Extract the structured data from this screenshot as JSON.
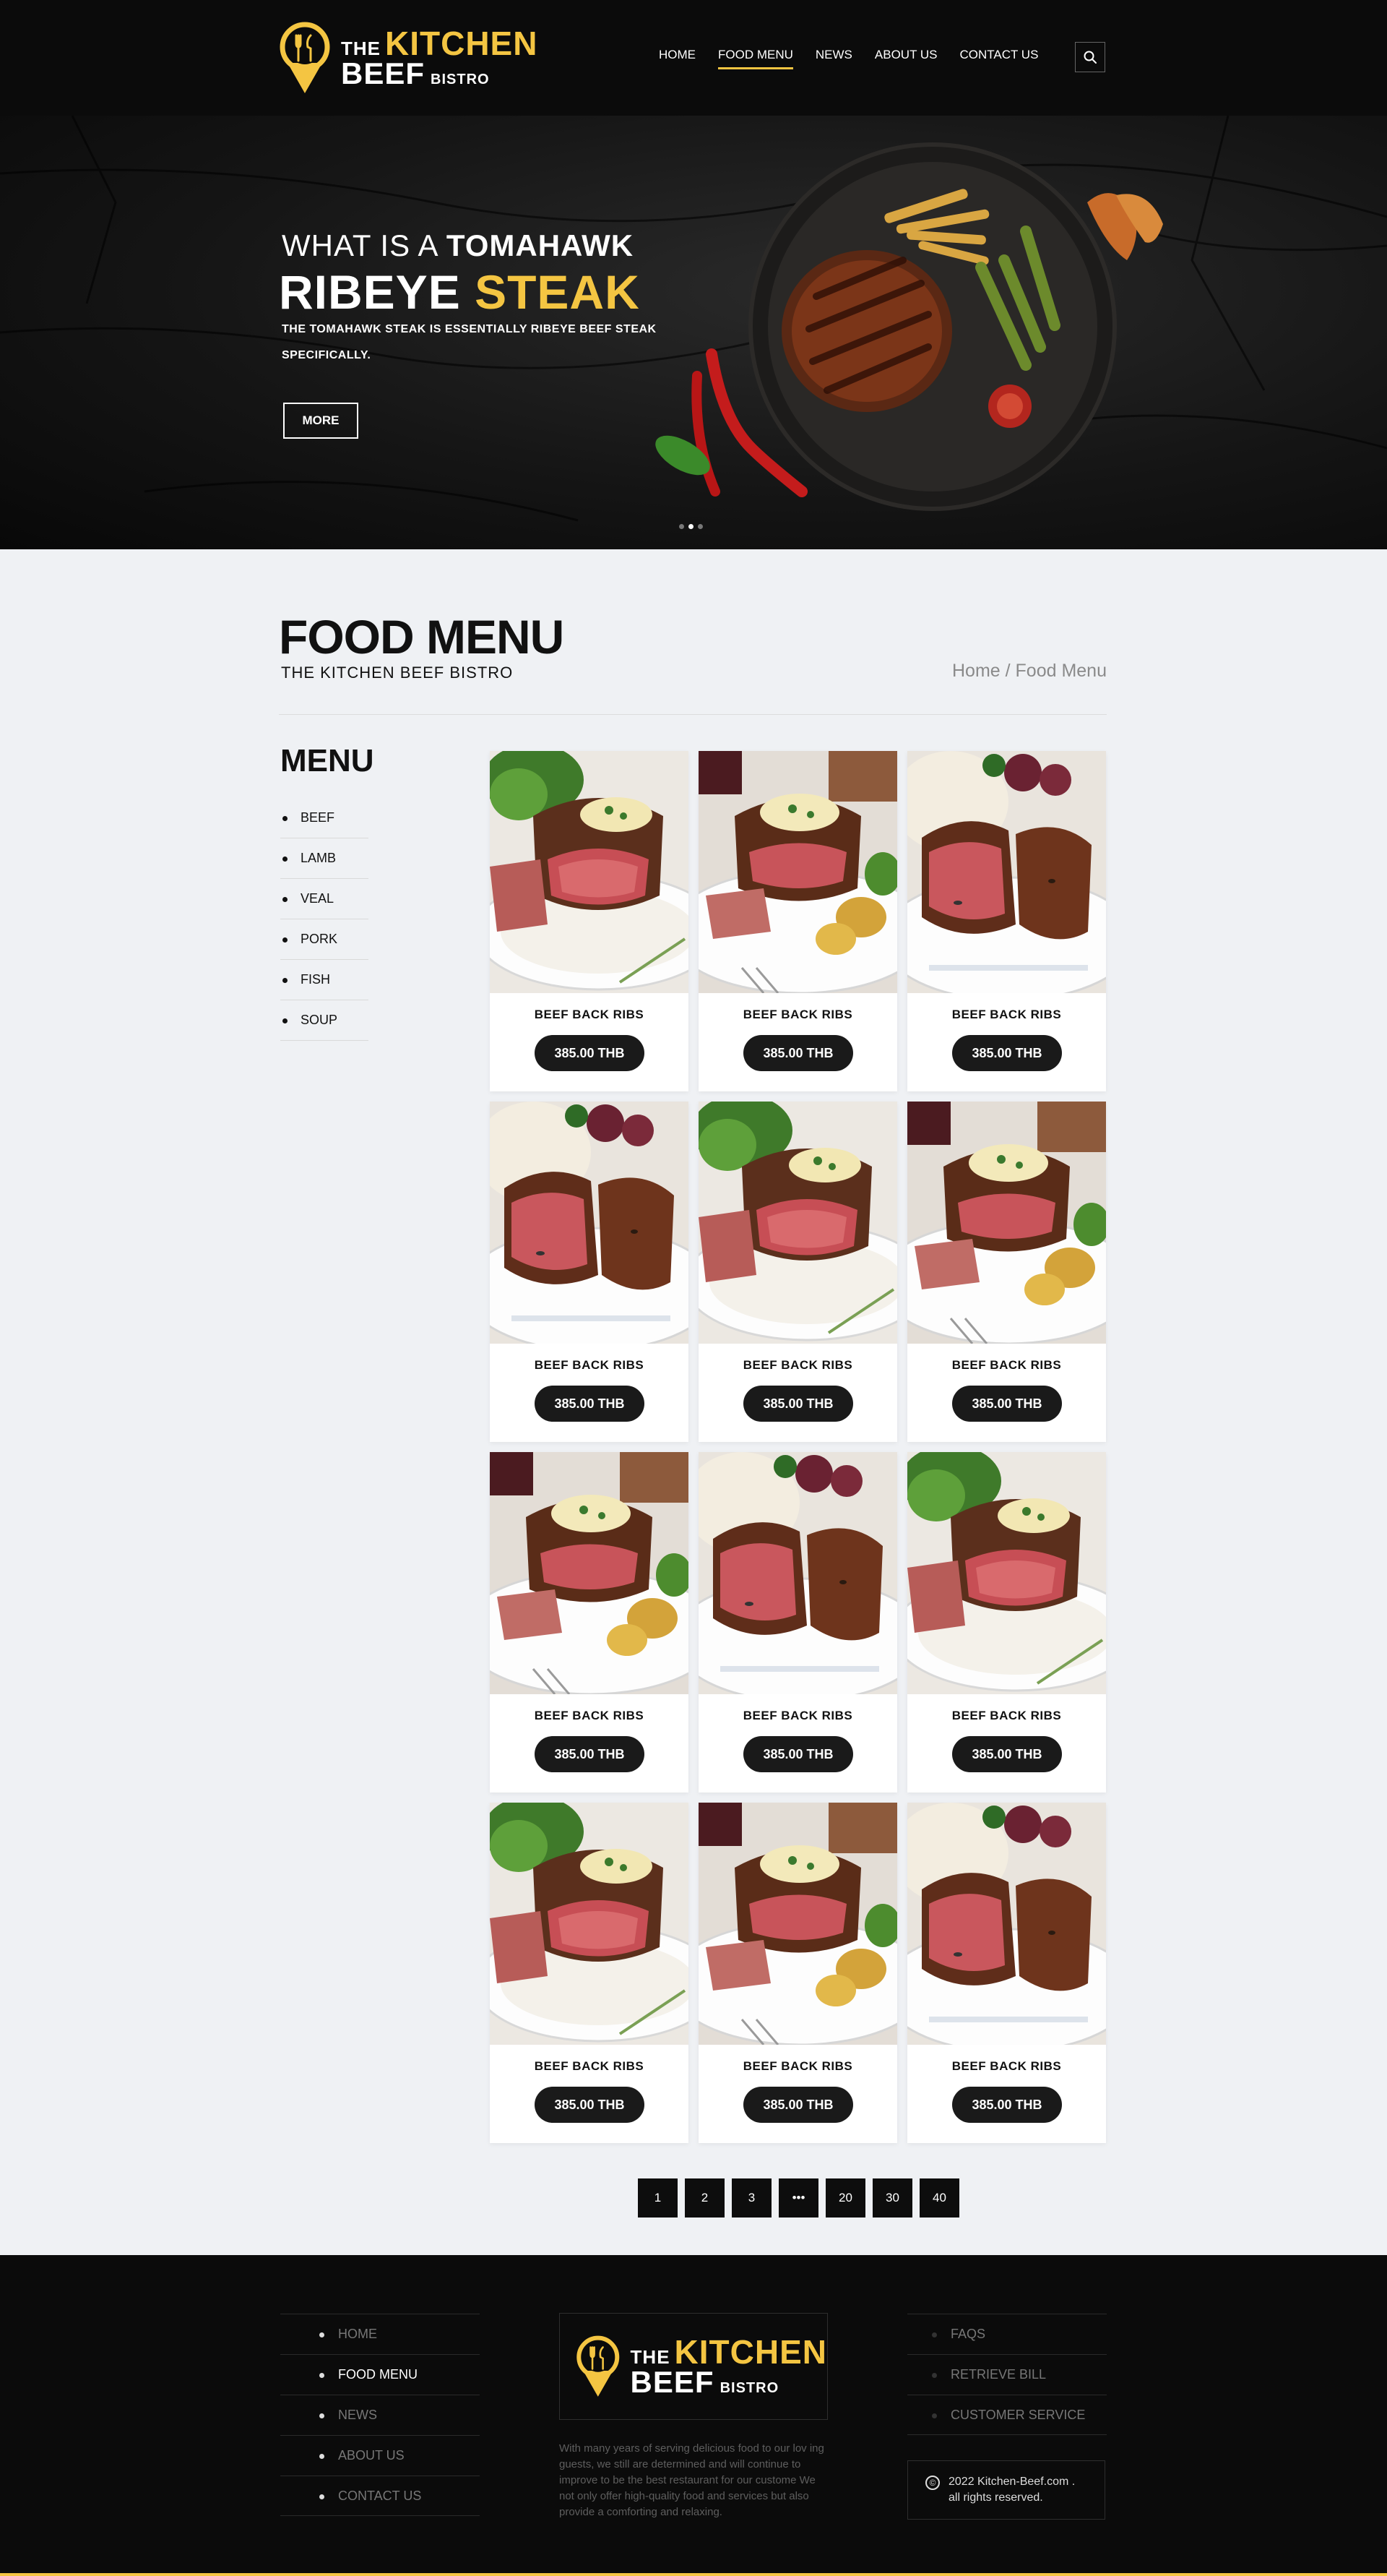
{
  "brand": {
    "the": "THE",
    "kitchen": "KITCHEN",
    "beef": "BEEF",
    "bistro": "BISTRO"
  },
  "nav": [
    {
      "label": "HOME"
    },
    {
      "label": "FOOD MENU",
      "active": true
    },
    {
      "label": "NEWS"
    },
    {
      "label": "ABOUT US"
    },
    {
      "label": "CONTACT US"
    }
  ],
  "search": {
    "icon": "search-icon"
  },
  "hero": {
    "line1_a": "WHAT IS A",
    "line1_b": "TOMAHAWK",
    "line2_a": "RIBEYE",
    "line2_b": "STEAK",
    "subtitle": "THE TOMAHAWK STEAK IS ESSENTIALLY RIBEYE BEEF STEAK SPECIFICALLY.",
    "button": "MORE",
    "slides": 3,
    "active_slide": 2
  },
  "page": {
    "title": "FOOD MENU",
    "subtitle": "THE KITCHEN BEEF BISTRO",
    "breadcrumb": "Home / Food Menu"
  },
  "sidebar": {
    "heading": "MENU",
    "items": [
      {
        "label": "BEEF"
      },
      {
        "label": "LAMB"
      },
      {
        "label": "VEAL"
      },
      {
        "label": "PORK"
      },
      {
        "label": "FISH"
      },
      {
        "label": "SOUP"
      }
    ]
  },
  "products": [
    {
      "name": "BEEF BACK RIBS",
      "price": "385.00  THB"
    },
    {
      "name": "BEEF BACK RIBS",
      "price": "385.00  THB"
    },
    {
      "name": "BEEF BACK RIBS",
      "price": "385.00  THB"
    },
    {
      "name": "BEEF BACK RIBS",
      "price": "385.00  THB"
    },
    {
      "name": "BEEF BACK RIBS",
      "price": "385.00  THB"
    },
    {
      "name": "BEEF BACK RIBS",
      "price": "385.00  THB"
    },
    {
      "name": "BEEF BACK RIBS",
      "price": "385.00  THB"
    },
    {
      "name": "BEEF BACK RIBS",
      "price": "385.00  THB"
    },
    {
      "name": "BEEF BACK RIBS",
      "price": "385.00  THB"
    },
    {
      "name": "BEEF BACK RIBS",
      "price": "385.00  THB"
    },
    {
      "name": "BEEF BACK RIBS",
      "price": "385.00  THB"
    },
    {
      "name": "BEEF BACK RIBS",
      "price": "385.00  THB"
    }
  ],
  "pagination": [
    "1",
    "2",
    "3",
    "•••",
    "20",
    "30",
    "40"
  ],
  "footer": {
    "left_links": [
      {
        "label": "HOME"
      },
      {
        "label": "FOOD MENU",
        "active": true
      },
      {
        "label": "NEWS"
      },
      {
        "label": "ABOUT US"
      },
      {
        "label": "CONTACT US"
      }
    ],
    "right_links": [
      {
        "label": "FAQS"
      },
      {
        "label": "RETRIEVE BILL"
      },
      {
        "label": "CUSTOMER SERVICE"
      }
    ],
    "description": "With many years of serving delicious food to our lov ing guests, we still are determined and will continue to improve to be the best restaurant for our custome We not only offer high-quality food and services but also provide a comforting and relaxing.",
    "copyright_symbol": "©",
    "copyright_line1": "2022 Kitchen-Beef.com .",
    "copyright_line2": "all rights reserved."
  },
  "colors": {
    "accent": "#f4c542",
    "dark": "#0b0b0b",
    "page_bg": "#eff1f4"
  }
}
